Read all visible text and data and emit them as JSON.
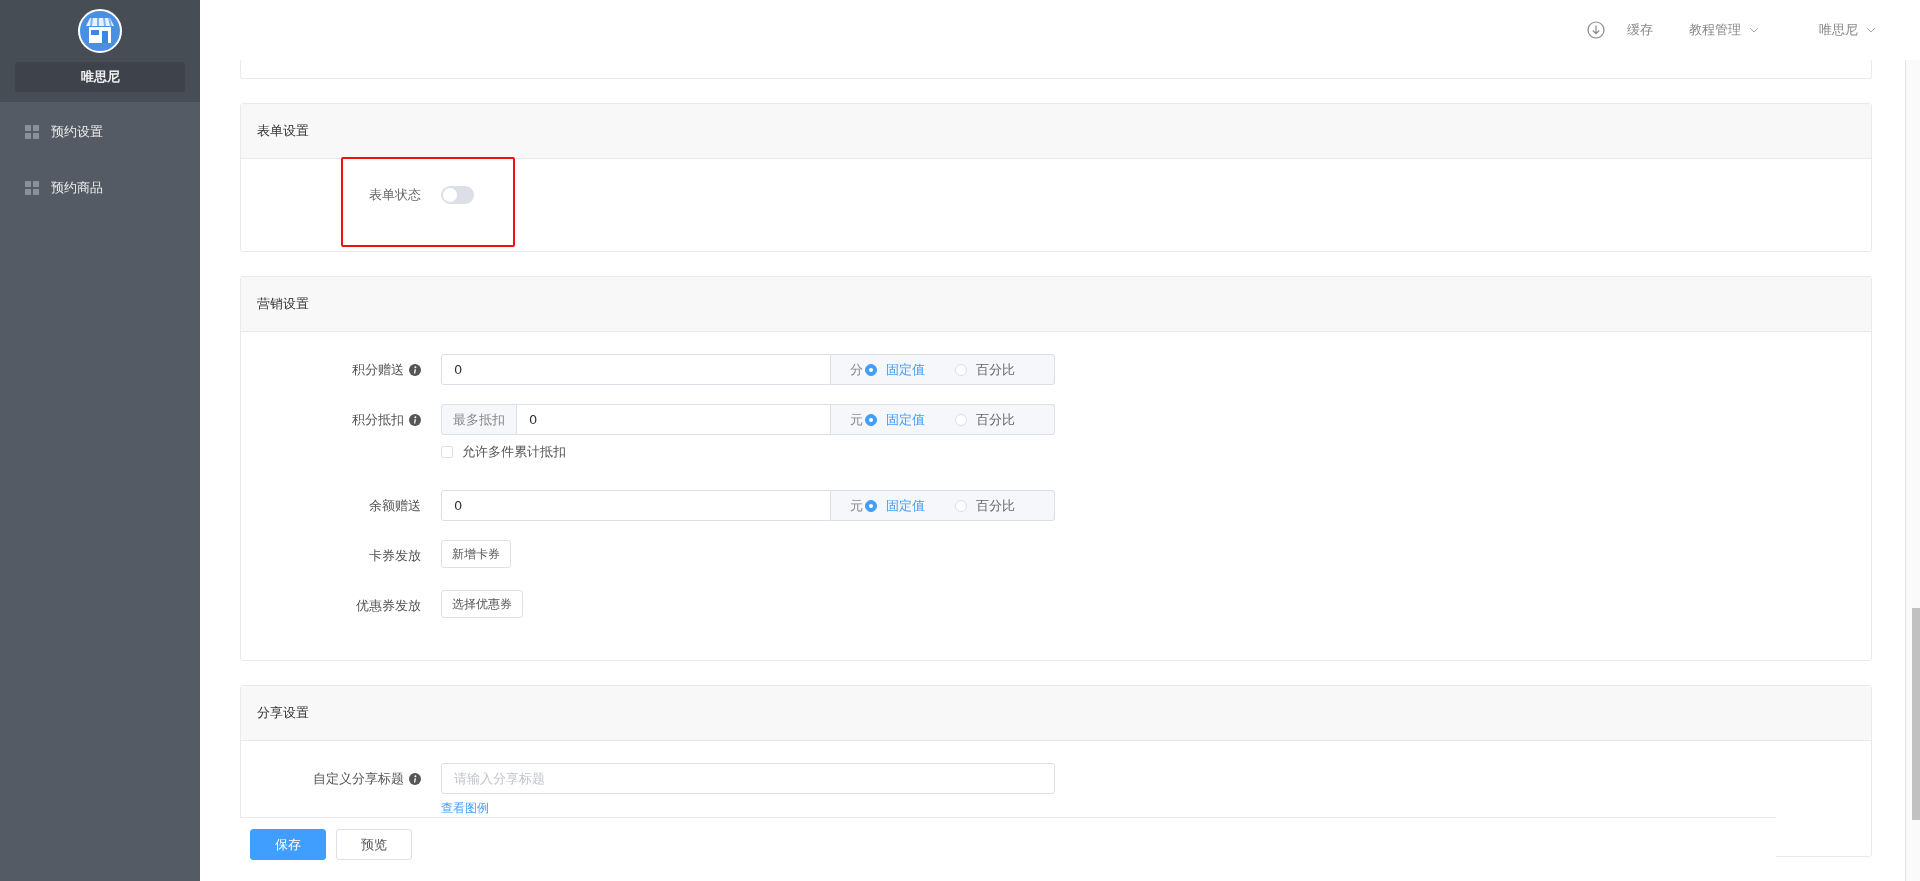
{
  "sidebar": {
    "shop_name": "唯思尼",
    "items": [
      {
        "label": "预约设置",
        "selected": false
      },
      {
        "label": "预约商品",
        "selected": false
      }
    ]
  },
  "header": {
    "cache_label": "缓存",
    "menus": [
      {
        "label": "教程管理"
      },
      {
        "label": "唯思尼"
      }
    ]
  },
  "sections": [
    {
      "title": "表单设置",
      "highlighted": true,
      "fields": [
        {
          "kind": "switch",
          "label": "表单状态",
          "on": false
        }
      ]
    },
    {
      "title": "营销设置",
      "highlighted": false,
      "fields": [
        {
          "kind": "addon",
          "label": "积分赠送",
          "info": true,
          "value": "0",
          "unit": "分",
          "options": [
            {
              "label": "固定值",
              "selected": true
            },
            {
              "label": "百分比",
              "selected": false
            }
          ]
        },
        {
          "kind": "addon",
          "label": "积分抵扣",
          "info": true,
          "prefix": "最多抵扣",
          "value": "0",
          "unit": "元",
          "options": [
            {
              "label": "固定值",
              "selected": true
            },
            {
              "label": "百分比",
              "selected": false
            }
          ],
          "checkbox": {
            "label": "允许多件累计抵扣",
            "checked": false
          }
        },
        {
          "kind": "addon",
          "label": "余额赠送",
          "info": false,
          "value": "0",
          "unit": "元",
          "options": [
            {
              "label": "固定值",
              "selected": true
            },
            {
              "label": "百分比",
              "selected": false
            }
          ]
        },
        {
          "kind": "button",
          "label": "卡券发放",
          "info": false,
          "button": "新增卡券"
        },
        {
          "kind": "button",
          "label": "优惠券发放",
          "info": false,
          "button": "选择优惠券"
        }
      ]
    },
    {
      "title": "分享设置",
      "highlighted": false,
      "fields": [
        {
          "kind": "text",
          "label": "自定义分享标题",
          "info": true,
          "placeholder": "请输入分享标题",
          "link": "查看图例"
        }
      ]
    }
  ],
  "footer": {
    "buttons": [
      {
        "label": "保存",
        "kind": "primary"
      },
      {
        "label": "预览",
        "kind": "default"
      }
    ]
  }
}
